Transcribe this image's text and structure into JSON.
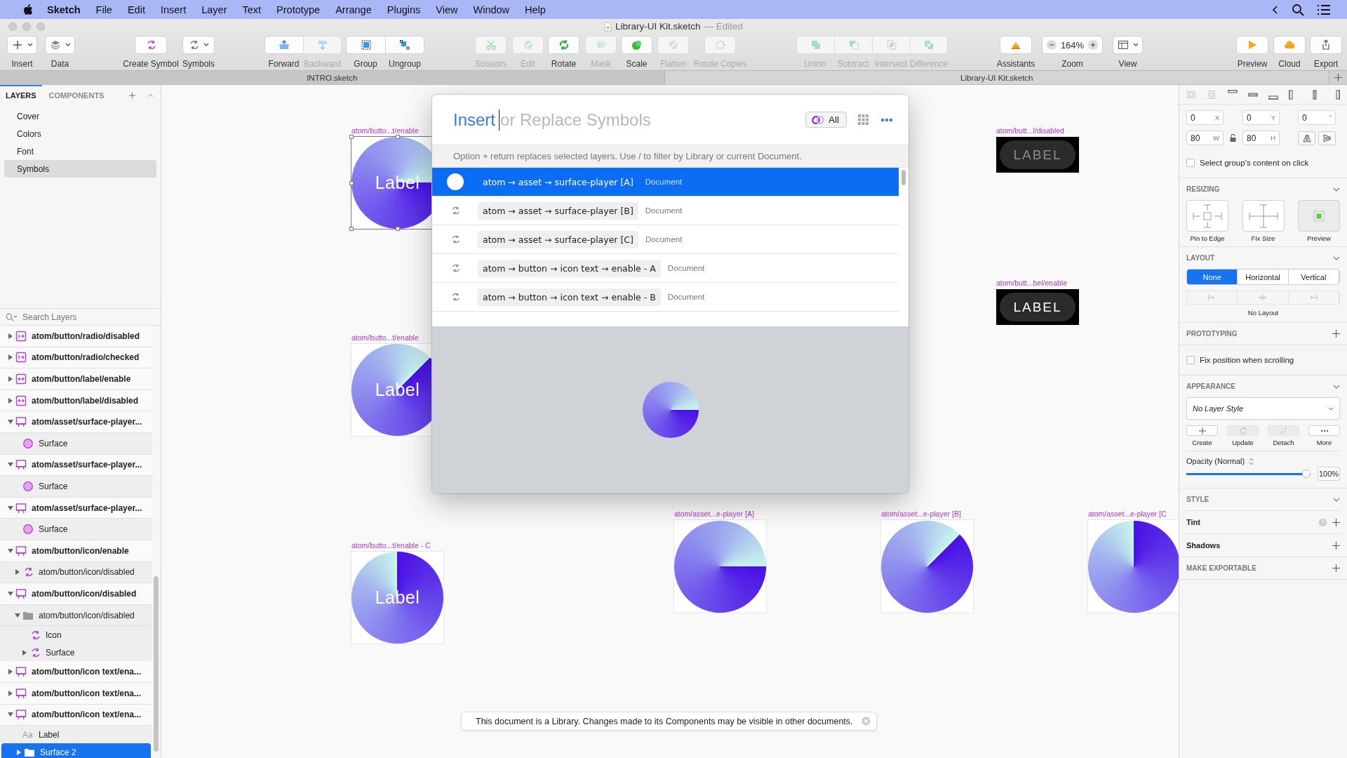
{
  "menubar": {
    "menus": [
      "Sketch",
      "File",
      "Edit",
      "Insert",
      "Layer",
      "Text",
      "Prototype",
      "Arrange",
      "Plugins",
      "View",
      "Window",
      "Help"
    ]
  },
  "window": {
    "title": "Library-UI Kit.sketch",
    "status": "— Edited"
  },
  "toolbar": [
    {
      "label": "Insert",
      "disabled": false
    },
    {
      "label": "Data",
      "disabled": false
    },
    {
      "label": "Create Symbol",
      "disabled": false
    },
    {
      "label": "Symbols",
      "disabled": false
    },
    {
      "label": "Forward",
      "disabled": false
    },
    {
      "label": "Backward",
      "disabled": true
    },
    {
      "label": "Group",
      "disabled": false
    },
    {
      "label": "Ungroup",
      "disabled": false
    },
    {
      "label": "Scissors",
      "disabled": true
    },
    {
      "label": "Edit",
      "disabled": true
    },
    {
      "label": "Rotate",
      "disabled": false
    },
    {
      "label": "Mask",
      "disabled": true
    },
    {
      "label": "Scale",
      "disabled": false
    },
    {
      "label": "Flatten",
      "disabled": true
    },
    {
      "label": "Rotate Copies",
      "disabled": true
    },
    {
      "label": "Union",
      "disabled": true
    },
    {
      "label": "Subtract",
      "disabled": true
    },
    {
      "label": "Intersect",
      "disabled": true
    },
    {
      "label": "Difference",
      "disabled": true
    },
    {
      "label": "Assistants",
      "disabled": false
    },
    {
      "label": "Zoom",
      "disabled": false,
      "value": "164%"
    },
    {
      "label": "View",
      "disabled": false
    },
    {
      "label": "Preview",
      "disabled": false
    },
    {
      "label": "Cloud",
      "disabled": false
    },
    {
      "label": "Export",
      "disabled": false
    }
  ],
  "tabs": [
    {
      "label": "INTRO.sketch",
      "selected": false
    },
    {
      "label": "Library-UI Kit.sketch",
      "selected": true
    }
  ],
  "sidebar_tabs": [
    {
      "label": "LAYERS",
      "selected": true
    },
    {
      "label": "COMPONENTS",
      "selected": false
    }
  ],
  "pages": [
    {
      "label": "Cover",
      "selected": false
    },
    {
      "label": "Colors",
      "selected": false
    },
    {
      "label": "Font",
      "selected": false
    },
    {
      "label": "Symbols",
      "selected": true
    }
  ],
  "layers": {
    "search_placeholder": "Search Layers",
    "items": [
      {
        "name": "atom/button/radio/disabled",
        "kind": "radio",
        "expanded": false,
        "selected": false
      },
      {
        "name": "atom/button/radio/checked",
        "kind": "radio",
        "expanded": false,
        "selected": false
      },
      {
        "name": "atom/button/label/enable",
        "kind": "label",
        "expanded": false,
        "selected": false
      },
      {
        "name": "atom/button/label/disabled",
        "kind": "label",
        "expanded": false,
        "selected": false
      },
      {
        "name": "atom/asset/surface-player...",
        "kind": "artboard",
        "expanded": true,
        "selected": false,
        "children": [
          {
            "name": "Surface",
            "kind": "oval",
            "selected": false
          }
        ]
      },
      {
        "name": "atom/asset/surface-player...",
        "kind": "artboard",
        "expanded": true,
        "selected": false,
        "children": [
          {
            "name": "Surface",
            "kind": "oval",
            "selected": false
          }
        ]
      },
      {
        "name": "atom/asset/surface-player...",
        "kind": "artboard",
        "expanded": true,
        "selected": false,
        "children": [
          {
            "name": "Surface",
            "kind": "oval",
            "selected": false
          }
        ]
      },
      {
        "name": "atom/button/icon/enable",
        "kind": "artboard",
        "expanded": true,
        "selected": false,
        "children": [
          {
            "name": "atom/button/icon/disabled",
            "kind": "symbol",
            "expanded": false,
            "selected": false
          }
        ]
      },
      {
        "name": "atom/button/icon/disabled",
        "kind": "artboard",
        "expanded": true,
        "selected": false,
        "children": [
          {
            "name": "atom/button/icon/disabled",
            "kind": "group",
            "expanded": true,
            "selected": false,
            "children": [
              {
                "name": "Icon",
                "kind": "symbol",
                "selected": false
              },
              {
                "name": "Surface",
                "kind": "symbol",
                "expanded": false,
                "selected": false
              }
            ]
          }
        ]
      },
      {
        "name": "atom/button/icon text/ena...",
        "kind": "artboard",
        "expanded": false,
        "selected": false
      },
      {
        "name": "atom/button/icon text/ena...",
        "kind": "artboard",
        "expanded": false,
        "selected": false
      },
      {
        "name": "atom/button/icon text/ena...",
        "kind": "artboard",
        "expanded": true,
        "selected": false,
        "children": [
          {
            "name": "Label",
            "kind": "text",
            "glyph": "Aa",
            "selected": false
          },
          {
            "name": "Surface 2",
            "kind": "group",
            "expanded": false,
            "selected": true
          }
        ]
      }
    ]
  },
  "canvas": {
    "symbols": [
      {
        "name": "atom/butto...t/enable",
        "label": "Label",
        "selected": true
      },
      {
        "name": "atom/butto...t/enable",
        "label": "Label",
        "selected": false
      },
      {
        "name": "atom/butto...t/enable - C",
        "label": "Label",
        "selected": false
      }
    ],
    "assets": [
      {
        "name": "atom/asset...e-player [A]"
      },
      {
        "name": "atom/asset...e-player [B]"
      },
      {
        "name": "atom/asset...e-player [C"
      }
    ],
    "label_buttons": [
      {
        "name": "atom/butt...l/disabled",
        "label": "LABEL",
        "disabled": true
      },
      {
        "name": "atom/butt...bel/enable",
        "label": "LABEL",
        "disabled": false
      }
    ]
  },
  "dialog": {
    "search": {
      "mode": "Insert",
      "placeholder": "or Replace Symbols"
    },
    "filter": "All",
    "hint": "Option + return replaces selected layers. Use / to filter by Library or current Document.",
    "results": [
      {
        "name": "atom → asset → surface-player [A]",
        "source": "Document",
        "selected": true
      },
      {
        "name": "atom → asset → surface-player [B]",
        "source": "Document",
        "selected": false
      },
      {
        "name": "atom → asset → surface-player [C]",
        "source": "Document",
        "selected": false
      },
      {
        "name": "atom → button → icon text → enable - A",
        "source": "Document",
        "selected": false
      },
      {
        "name": "atom → button → icon text → enable - B",
        "source": "Document",
        "selected": false
      }
    ]
  },
  "toast": "This document is a Library. Changes made to its Components may be visible in other documents.",
  "inspector": {
    "position": [
      {
        "value": "0",
        "unit": "X"
      },
      {
        "value": "0",
        "unit": "Y"
      },
      {
        "value": "0",
        "unit": "°"
      }
    ],
    "size": [
      {
        "value": "80",
        "unit": "W"
      },
      {
        "value": "80",
        "unit": "H"
      }
    ],
    "select_content": {
      "label": "Select group’s content on click",
      "checked": false
    },
    "resizing": {
      "title": "RESIZING",
      "options": [
        "Pin to Edge",
        "Fix Size",
        "Preview"
      ]
    },
    "layout": {
      "title": "LAYOUT",
      "modes": [
        {
          "label": "None",
          "selected": true
        },
        {
          "label": "Horizontal",
          "selected": false
        },
        {
          "label": "Vertical",
          "selected": false
        }
      ],
      "note": "No Layout"
    },
    "prototyping": {
      "title": "PROTOTYPING",
      "checkbox": {
        "label": "Fix position when scrolling",
        "checked": false
      }
    },
    "appearance": {
      "title": "APPEARANCE",
      "layer_style": "No Layer Style",
      "actions": [
        {
          "label": "Create",
          "disabled": false
        },
        {
          "label": "Update",
          "disabled": true
        },
        {
          "label": "Detach",
          "disabled": true
        },
        {
          "label": "More",
          "disabled": false
        }
      ],
      "opacity_label": "Opacity (Normal)",
      "opacity": {
        "level": 1
      },
      "opacity_value": "100%"
    },
    "style": {
      "title": "STYLE",
      "rows": [
        {
          "label": "Tint",
          "help": true
        },
        {
          "label": "Shadows",
          "help": false
        }
      ]
    },
    "export": {
      "title": "MAKE EXPORTABLE"
    }
  }
}
